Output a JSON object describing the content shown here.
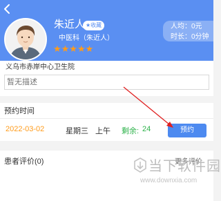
{
  "doctor": {
    "name": "朱近人",
    "collect_label": "★收藏",
    "department": "中医科（朱近人）",
    "stars": "★★★★★",
    "visitors": "人均：0元",
    "duration": "时长：0分钟"
  },
  "hospital": {
    "name": "义乌市赤岸中心卫生院",
    "description_placeholder": "暂无描述"
  },
  "appointment": {
    "section_title": "预约时间",
    "date": "2022-03-02",
    "weekday": "星期三",
    "period": "上午",
    "remain_label": "剩余:",
    "remain": "24",
    "book_label": "预约"
  },
  "reviews": {
    "title": "患者评价(0)",
    "more_label": "更多评价"
  },
  "watermark": {
    "brand": "当下软件园",
    "url": "www.downxia.com"
  },
  "colors": {
    "header": "#5a8ff2",
    "star": "#ff9b1a",
    "remain": "#2cb24a",
    "button": "#4d8af0",
    "arrow": "#e02020"
  },
  "icons": {
    "back": "back-arrow-icon",
    "avatar": "doctor-avatar",
    "watermark": "watermark-logo-icon"
  }
}
